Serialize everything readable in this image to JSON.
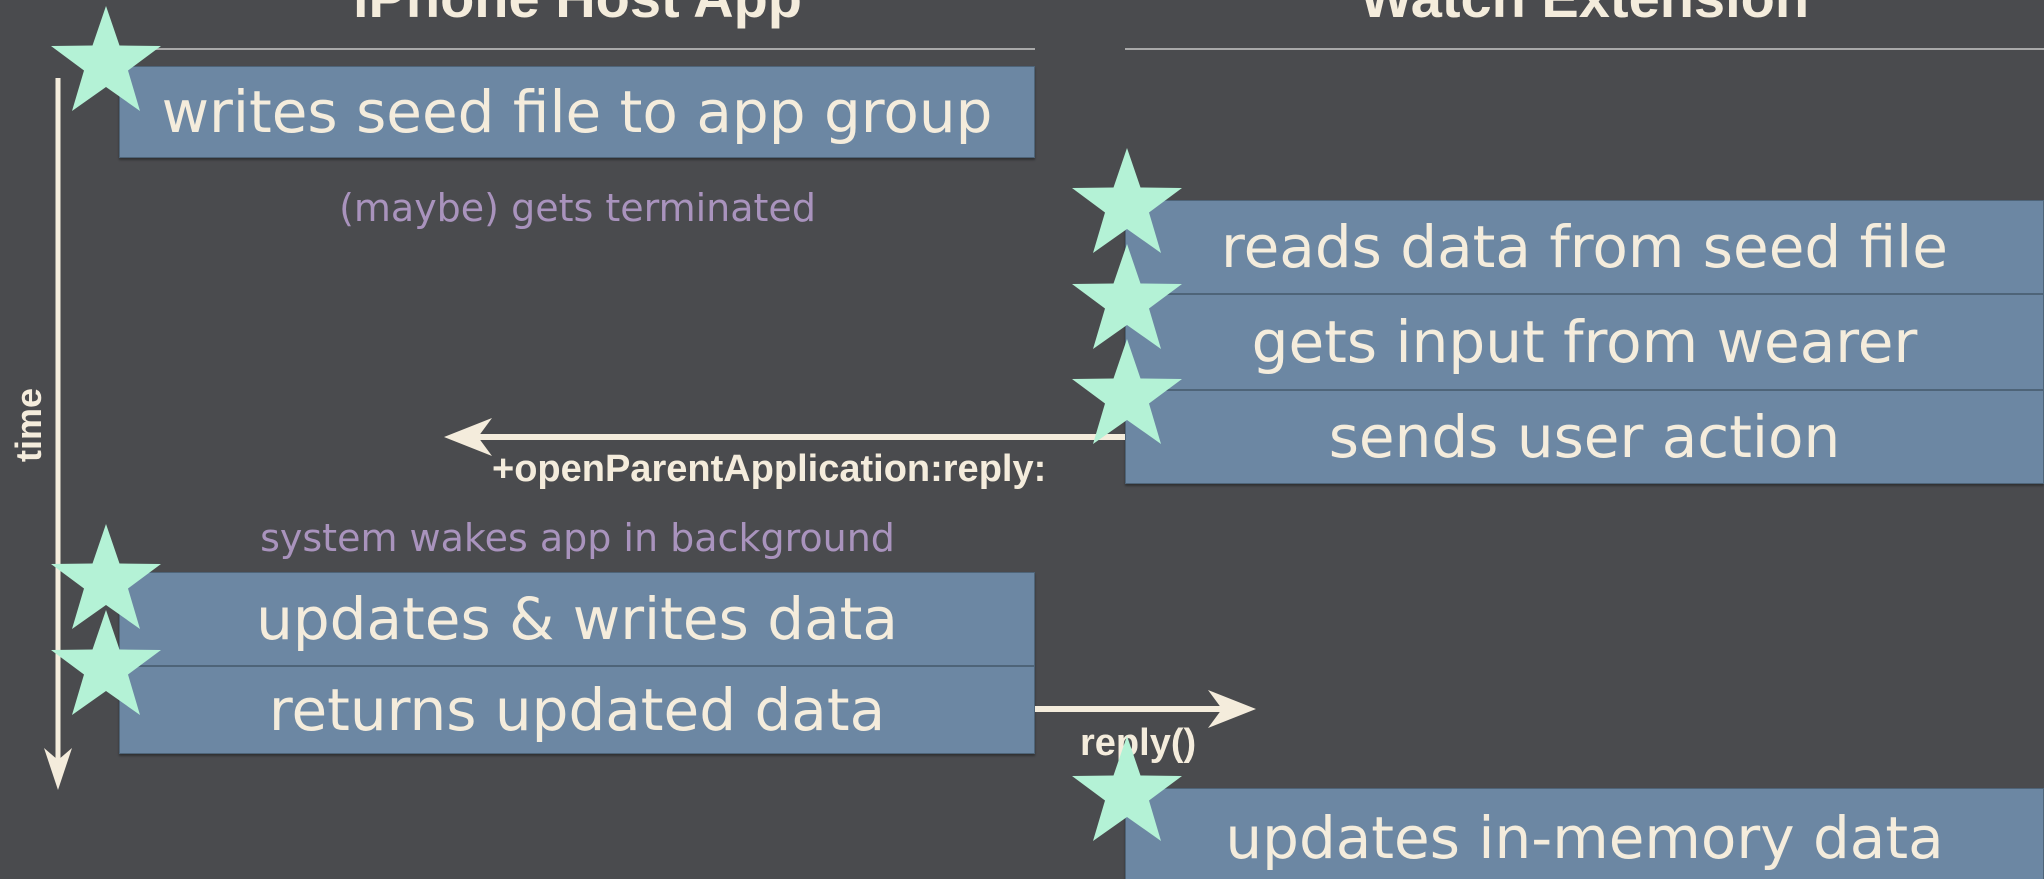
{
  "headers": {
    "left": "iPhone Host App",
    "right": "Watch Extension"
  },
  "axis": {
    "label": "time"
  },
  "steps": {
    "writes_seed": "writes seed file to app group",
    "reads_seed": "reads data from seed file",
    "gets_input": "gets input from wearer",
    "sends_action": "sends user action",
    "updates_writes": "updates & writes data",
    "returns_updated": "returns updated data",
    "updates_memory": "updates in-memory data"
  },
  "notes": {
    "terminated": "(maybe) gets terminated",
    "wakes": "system wakes app in background"
  },
  "messages": {
    "open_parent": "+openParentApplication:reply:",
    "reply": "reply()"
  },
  "colors": {
    "background": "#4a4b4e",
    "box": "#6c87a3",
    "text": "#f4ecdc",
    "note": "#a993bd",
    "star": "#b4f2d6",
    "arrow": "#f4ecdc"
  },
  "markers": {
    "icon": "star-icon"
  }
}
